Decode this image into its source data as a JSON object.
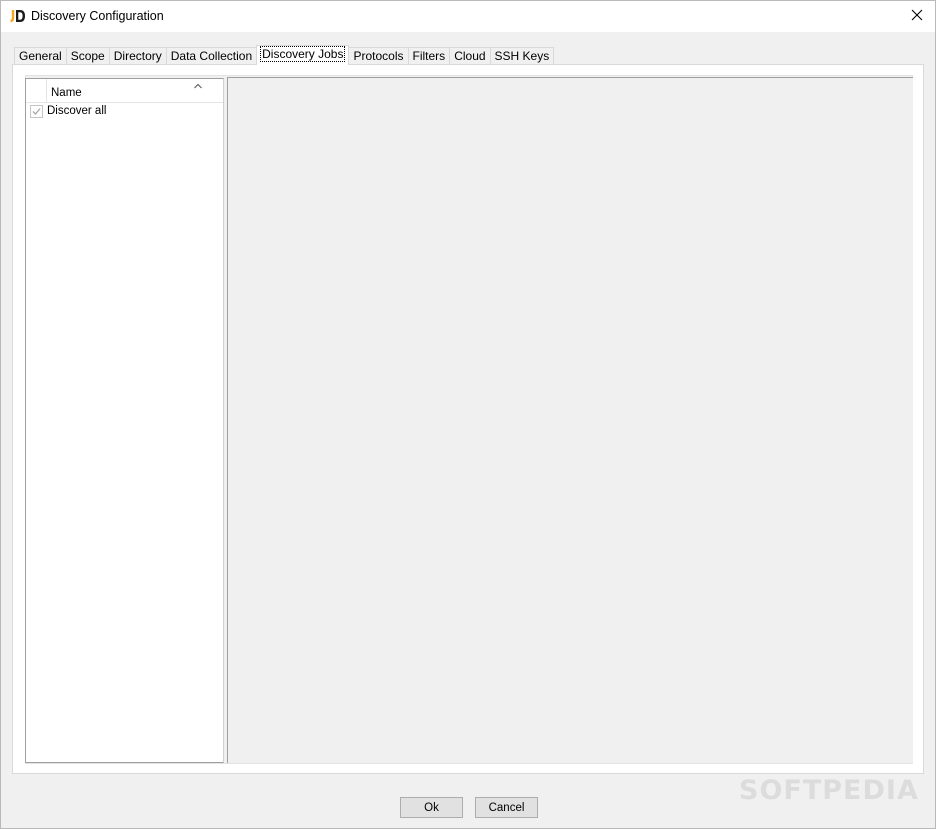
{
  "window": {
    "title": "Discovery Configuration",
    "app_icon": "jd-logo-icon",
    "close_icon": "close-icon"
  },
  "tabs": [
    {
      "label": "General",
      "active": false
    },
    {
      "label": "Scope",
      "active": false
    },
    {
      "label": "Directory",
      "active": false
    },
    {
      "label": "Data Collection",
      "active": false
    },
    {
      "label": "Discovery Jobs",
      "active": true
    },
    {
      "label": "Protocols",
      "active": false
    },
    {
      "label": "Filters",
      "active": false
    },
    {
      "label": "Cloud",
      "active": false
    },
    {
      "label": "SSH Keys",
      "active": false
    }
  ],
  "tree": {
    "column_header": "Name",
    "sort_icon": "sort-ascending-icon",
    "rows": [
      {
        "label": "Discover all",
        "checked": true
      }
    ]
  },
  "buttons": {
    "ok": "Ok",
    "cancel": "Cancel"
  },
  "watermark": "SOFTPEDIA",
  "colors": {
    "logo_orange": "#f5a623",
    "logo_dark": "#1a1a1a",
    "window_bg": "#f0f0f0"
  }
}
